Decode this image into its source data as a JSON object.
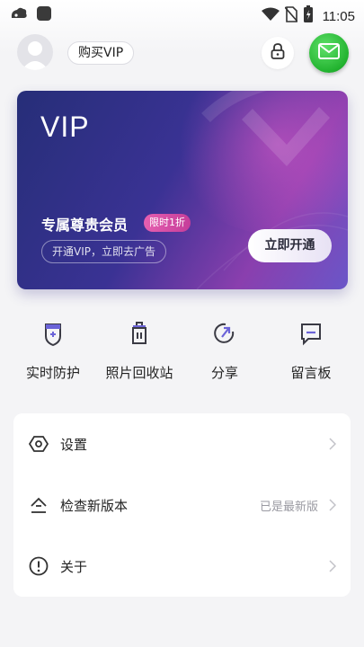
{
  "status_bar": {
    "time": "11:05",
    "icons": [
      "notification-icon",
      "app-icon",
      "wifi-icon",
      "no-sim-icon",
      "battery-icon"
    ]
  },
  "header": {
    "vip_button_label": "购买VIP",
    "icons": [
      "avatar",
      "lock-icon",
      "mail-icon"
    ]
  },
  "vip_card": {
    "title": "VIP",
    "subtitle": "专属尊贵会员",
    "badge": "限时1折",
    "ad_text": "开通VIP，立即去广告",
    "cta": "立即开通"
  },
  "quick_actions": [
    {
      "label": "实时防护",
      "icon": "shield-icon"
    },
    {
      "label": "照片回收站",
      "icon": "trash-icon"
    },
    {
      "label": "分享",
      "icon": "share-icon"
    },
    {
      "label": "留言板",
      "icon": "message-icon"
    }
  ],
  "settings_list": [
    {
      "label": "设置",
      "value": "",
      "icon": "settings-icon"
    },
    {
      "label": "检查新版本",
      "value": "已是最新版",
      "icon": "update-icon"
    },
    {
      "label": "关于",
      "value": "",
      "icon": "info-icon"
    }
  ],
  "colors": {
    "mail_green": "#22b32f",
    "card_start": "#262e78",
    "card_end": "#8a3fae",
    "badge_pink": "#e65fb0"
  }
}
